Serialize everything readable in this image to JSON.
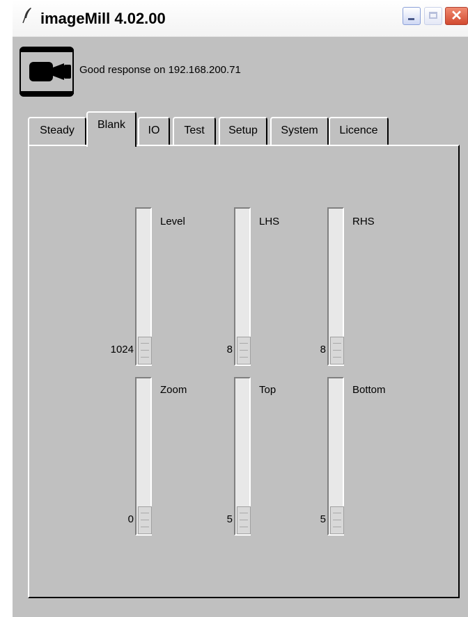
{
  "window": {
    "title": "imageMill 4.02.00",
    "icons": {
      "app": "quill-pen-icon",
      "minimize": "minimize-icon",
      "maximize": "maximize-icon",
      "close": "close-icon"
    },
    "close_glyph": "✕"
  },
  "status": {
    "icon": "video-camera-icon",
    "text": "Good response on 192.168.200.71"
  },
  "tabs": [
    {
      "label": "Steady",
      "active": false
    },
    {
      "label": "Blank",
      "active": true
    },
    {
      "label": "IO",
      "active": false
    },
    {
      "label": "Test",
      "active": false
    },
    {
      "label": "Setup",
      "active": false
    },
    {
      "label": "System",
      "active": false
    },
    {
      "label": "Licence",
      "active": false
    }
  ],
  "sliders": [
    {
      "label": "Level",
      "value": "1024"
    },
    {
      "label": "LHS",
      "value": "8"
    },
    {
      "label": "RHS",
      "value": "8"
    },
    {
      "label": "Zoom",
      "value": "0"
    },
    {
      "label": "Top",
      "value": "5"
    },
    {
      "label": "Bottom",
      "value": "5"
    }
  ],
  "colors": {
    "face": "#c0c0c0",
    "close": "#d24a30"
  }
}
